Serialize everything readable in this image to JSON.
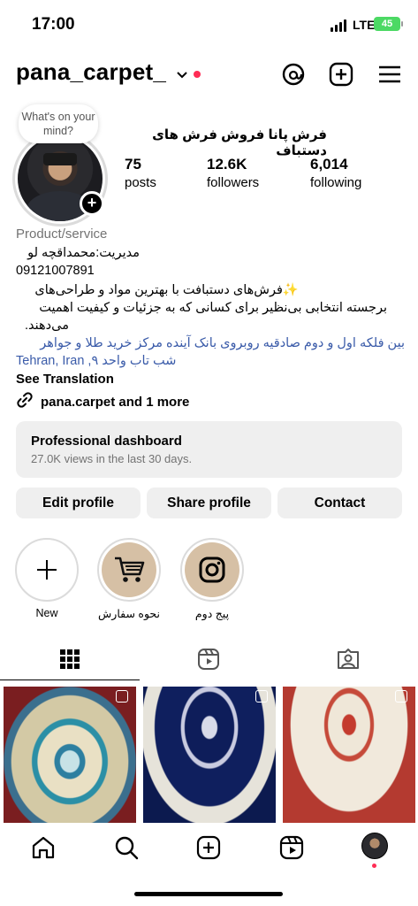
{
  "status": {
    "time": "17:00",
    "network": "LTE",
    "battery": "45"
  },
  "header": {
    "username": "pana_carpet_",
    "icons": [
      "threads-icon",
      "create-icon",
      "menu-icon"
    ]
  },
  "profile": {
    "bubble": "What's on your mind?",
    "display_name": "فرش پانا  فروش فرش های دستباف",
    "stats": [
      {
        "value": "75",
        "label": "posts"
      },
      {
        "value": "12.6K",
        "label": "followers"
      },
      {
        "value": "6,014",
        "label": "following"
      }
    ],
    "category": "Product/service",
    "bio": {
      "manager": "مدیریت:محمداقچه لو",
      "phone": "09121007891",
      "desc1": "✨فرش‌های دستبافت با بهترین مواد و طراحی‌های",
      "desc2": "برجسته انتخابی بی‌نظیر برای کسانی که به جزئیات و کیفیت اهمیت",
      "desc3": "می‌دهند.",
      "addr1": "بین فلکه اول و دوم صادقیه روبروی بانک آینده مرکز خرید طلا و جواهر",
      "addr2": "Tehran, Iran ,شب تاب واحد ۹"
    },
    "see_translation": "See Translation",
    "link": "pana.carpet and 1 more"
  },
  "dashboard": {
    "title": "Professional dashboard",
    "subtitle": "27.0K views in the last 30 days."
  },
  "buttons": {
    "edit": "Edit profile",
    "share": "Share profile",
    "contact": "Contact"
  },
  "highlights": [
    {
      "label": "New",
      "icon": "plus-icon"
    },
    {
      "label": "نحوه سفارش",
      "icon": "cart-icon"
    },
    {
      "label": "پیج دوم",
      "icon": "instagram-icon"
    }
  ],
  "tabs": [
    "grid-icon",
    "reels-icon",
    "tagged-icon"
  ],
  "nav": [
    "home-icon",
    "search-icon",
    "create-icon",
    "reels-icon",
    "profile-avatar"
  ]
}
